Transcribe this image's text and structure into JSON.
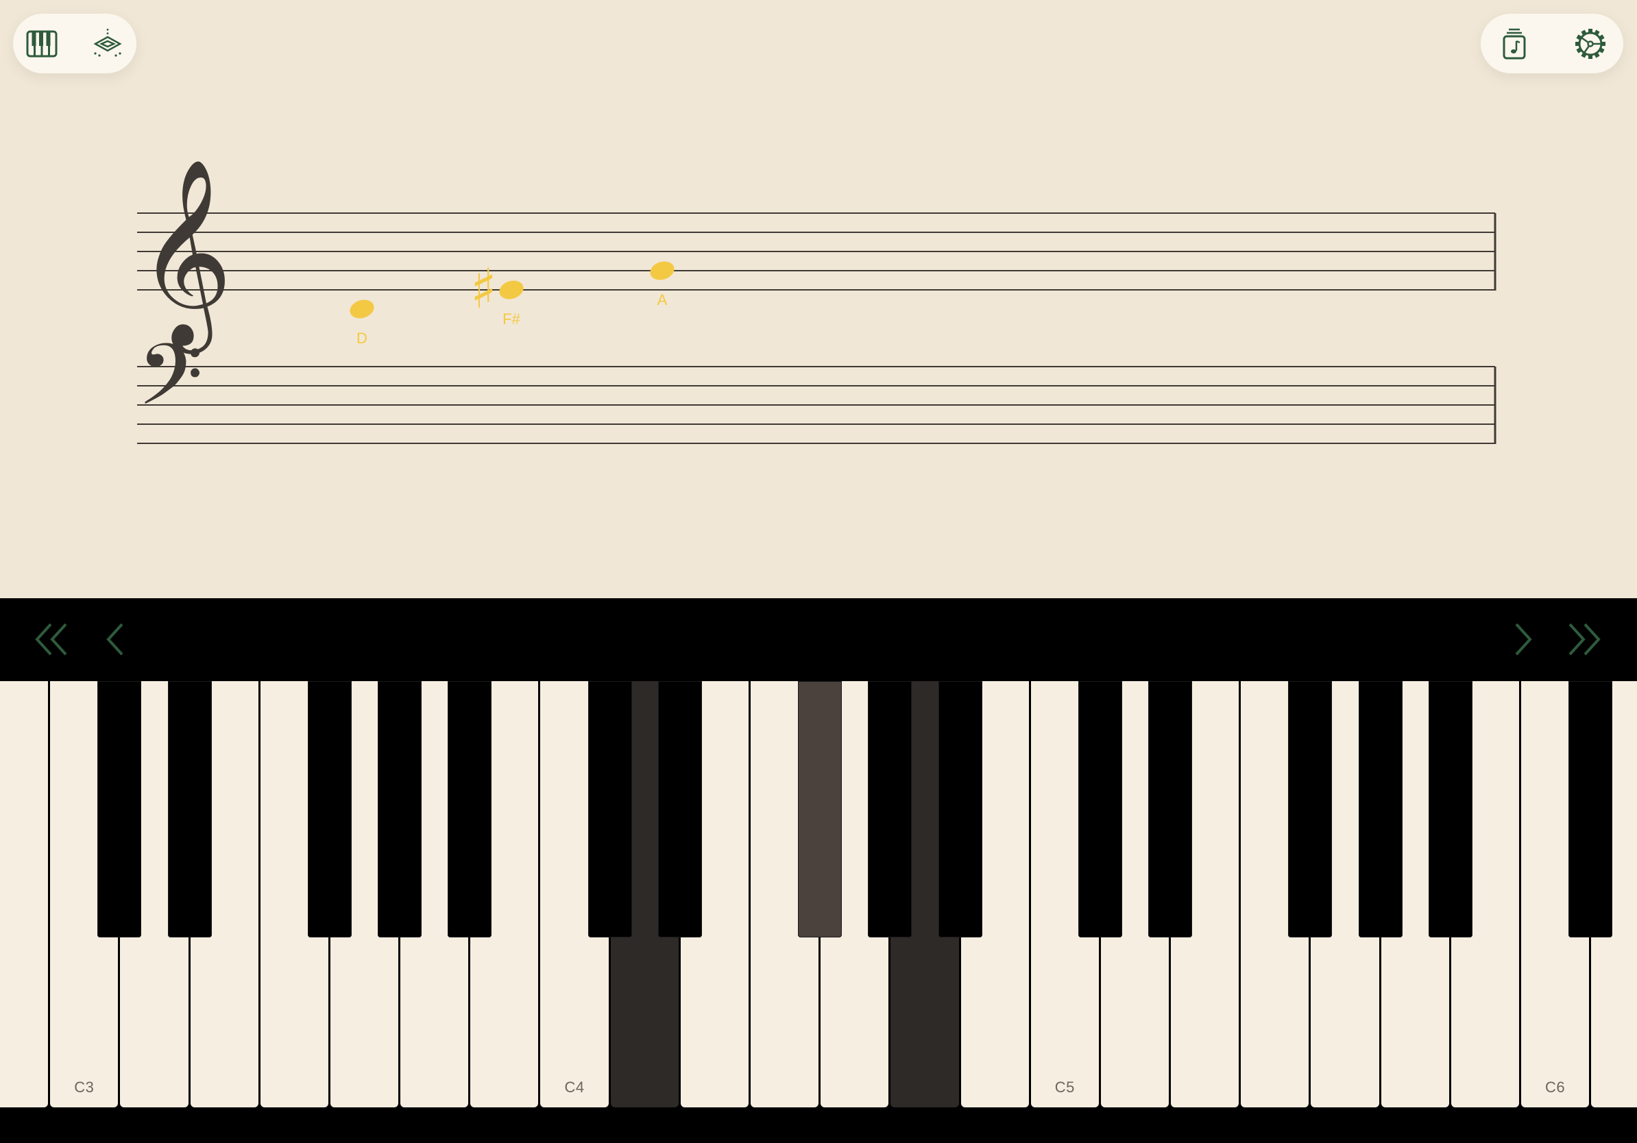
{
  "toolbar": {
    "left": [
      {
        "name": "piano-keyboard-icon",
        "label": "Keyboard"
      },
      {
        "name": "layers-icon",
        "label": "Layers"
      }
    ],
    "right": [
      {
        "name": "sheet-music-icon",
        "label": "Sheets"
      },
      {
        "name": "settings-gear-icon",
        "label": "Settings"
      }
    ]
  },
  "colors": {
    "background": "#f1e7d6",
    "staff_ink": "#3f3a35",
    "note_highlight": "#f3c944",
    "accent_green": "#2e5b3c",
    "white_key": "#f6eee1",
    "pressed_white_key": "#2e2a27",
    "pressed_black_key": "#4b423d"
  },
  "staff": {
    "treble_clef": "𝄞",
    "bass_clef": "𝄢",
    "notes": [
      {
        "name": "D",
        "label": "D",
        "accidental": ""
      },
      {
        "name": "F#",
        "label": "F#",
        "accidental": "♯"
      },
      {
        "name": "A",
        "label": "A",
        "accidental": ""
      }
    ]
  },
  "navigation": {
    "left": [
      "double-chevron-left-icon",
      "chevron-left-icon"
    ],
    "right": [
      "chevron-right-icon",
      "double-chevron-right-icon"
    ]
  },
  "keyboard": {
    "start_note": "B2",
    "white_key_count": 24,
    "octave_labels": [
      "C3",
      "C4",
      "C5",
      "C6"
    ],
    "pressed_keys": [
      "D4",
      "F#4",
      "A4"
    ]
  }
}
